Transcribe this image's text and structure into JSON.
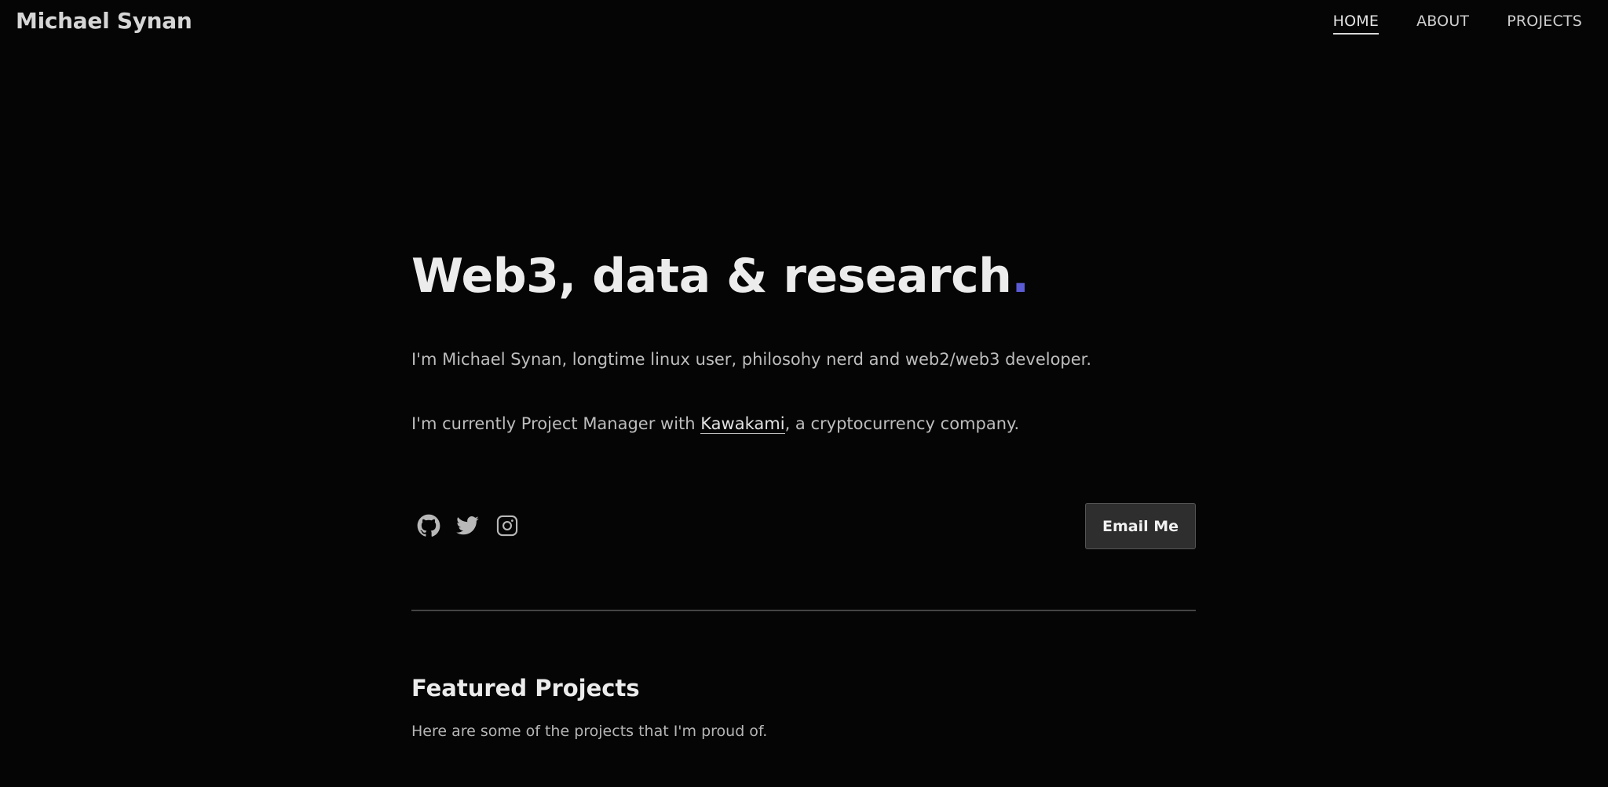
{
  "header": {
    "brand": "Michael Synan",
    "nav": [
      {
        "label": "HOME",
        "active": true
      },
      {
        "label": "ABOUT",
        "active": false
      },
      {
        "label": "PROJECTS",
        "active": false
      }
    ]
  },
  "hero": {
    "headline": "Web3, data & research",
    "headline_dot": ".",
    "intro": "I'm Michael Synan, longtime linux user, philosohy nerd and web2/web3 developer.",
    "current_prefix": "I'm currently Project Manager with ",
    "current_link": "Kawakami",
    "current_suffix": ", a cryptocurrency company."
  },
  "social": {
    "icons": [
      "github-icon",
      "twitter-icon",
      "instagram-icon"
    ]
  },
  "cta": {
    "email_label": "Email Me"
  },
  "featured": {
    "title": "Featured Projects",
    "subtitle": "Here are some of the projects that I'm proud of."
  },
  "colors": {
    "background": "#050505",
    "accent": "#5b5bd6",
    "button_bg": "#2e2e2e"
  }
}
